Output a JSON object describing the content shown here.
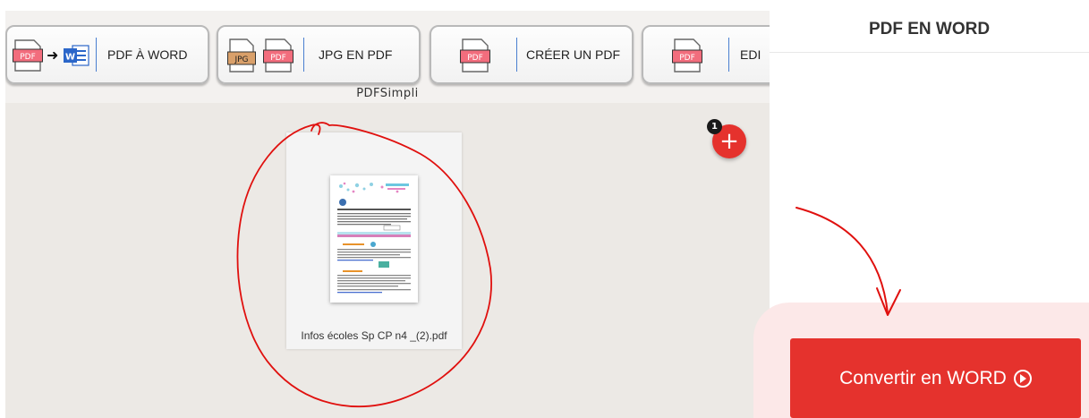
{
  "toolbar": {
    "tools": [
      {
        "label": "PDF À WORD"
      },
      {
        "label": "JPG EN PDF"
      },
      {
        "label": "CRÉER UN PDF"
      },
      {
        "label": "EDI"
      }
    ],
    "icons": {
      "pdf": "PDF",
      "jpg": "JPG",
      "word": "W"
    }
  },
  "brand": "PDFSimpli",
  "workspace": {
    "file_name": "Infos écoles Sp CP n4 _(2).pdf",
    "add_badge_count": "1",
    "add_symbol": "+"
  },
  "panel": {
    "title": "PDF EN WORD",
    "convert_label": "Convertir en WORD"
  },
  "colors": {
    "accent": "#e5322d",
    "cta_zone": "#fce8e8",
    "annotation": "#e0100e"
  }
}
